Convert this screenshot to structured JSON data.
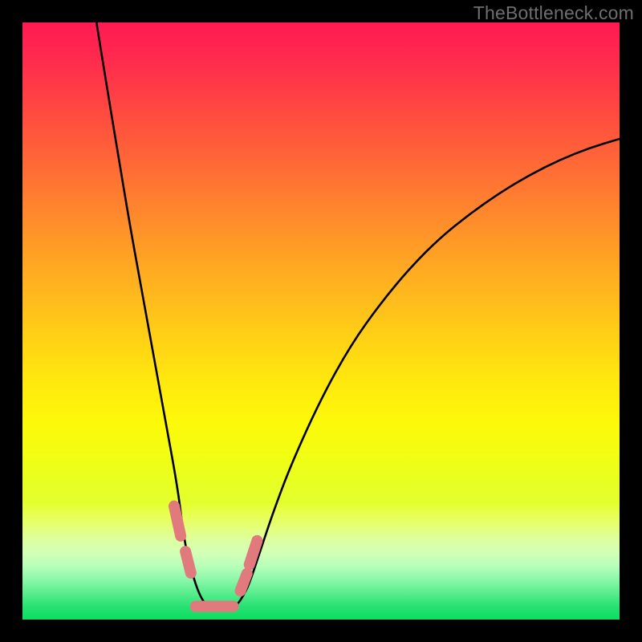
{
  "watermark_text": "TheBottleneck.com",
  "colors": {
    "page_bg": "#000000",
    "curve_stroke": "#000000",
    "marker_fill": "#e07a7d",
    "gradient_top": "#ff1a53",
    "gradient_bottom": "#0edd62"
  },
  "chart_data": {
    "type": "line",
    "title": "",
    "xlabel": "",
    "ylabel": "",
    "xlim": [
      0,
      100
    ],
    "ylim": [
      0,
      100
    ],
    "grid": false,
    "legend": false,
    "curve": {
      "name": "bottleneck-curve",
      "note": "V-shaped curve; minimum plateau near x≈28–36 at y≈2. Values estimated from pixel positions (plot area 744×744 mapped to 0–100).",
      "x": [
        12.4,
        14,
        16,
        18,
        20,
        22,
        24,
        26,
        27,
        28,
        30,
        32,
        34,
        35,
        36,
        37,
        38,
        40,
        42,
        45,
        50,
        55,
        60,
        65,
        70,
        75,
        80,
        85,
        90,
        95,
        100
      ],
      "y": [
        100,
        90,
        78,
        66,
        55,
        44,
        33,
        22,
        14,
        9,
        3,
        1.8,
        1.8,
        2.0,
        2.5,
        4.0,
        6.0,
        12,
        18,
        26,
        37,
        46,
        53,
        59,
        64,
        68,
        71.5,
        74.5,
        77,
        79,
        80.5
      ]
    },
    "markers": {
      "name": "highlight-pills",
      "note": "Rounded segments near the bottom of the V. Coordinates in same 0–100 space; each segment goes (x1,y1)→(x2,y2).",
      "segments": [
        {
          "x1": 25.4,
          "y1": 19.0,
          "x2": 26.5,
          "y2": 14.0
        },
        {
          "x1": 27.3,
          "y1": 11.4,
          "x2": 28.2,
          "y2": 7.8
        },
        {
          "x1": 29.0,
          "y1": 2.2,
          "x2": 35.3,
          "y2": 2.2
        },
        {
          "x1": 36.5,
          "y1": 4.8,
          "x2": 37.6,
          "y2": 7.7
        },
        {
          "x1": 38.0,
          "y1": 9.2,
          "x2": 39.3,
          "y2": 13.2
        }
      ]
    }
  }
}
